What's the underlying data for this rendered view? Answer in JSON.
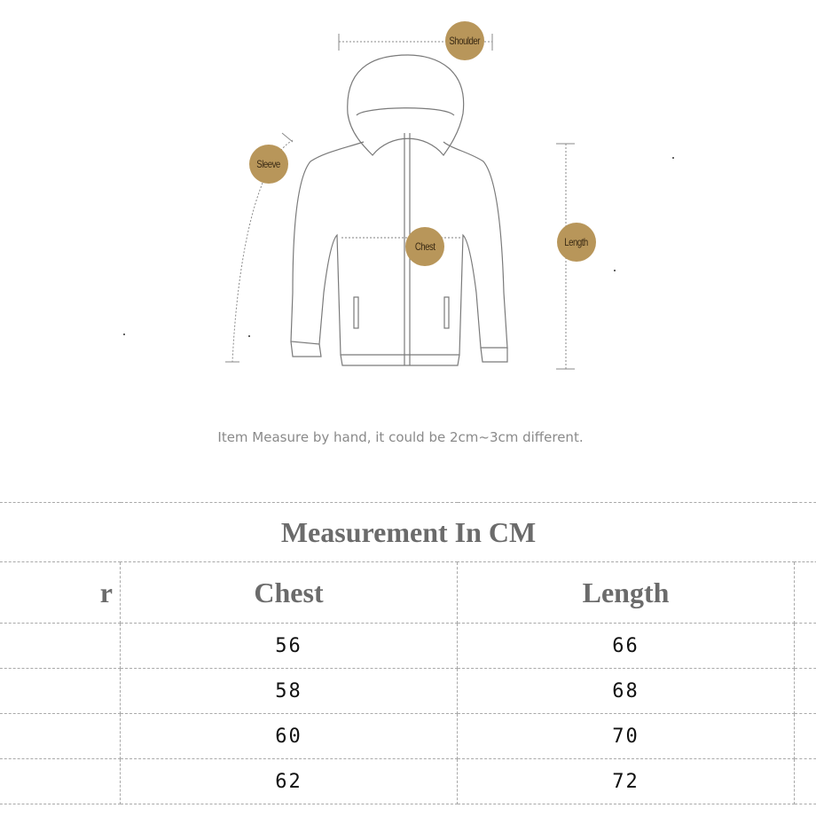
{
  "diagram": {
    "labels": {
      "shoulder": "Shoulder",
      "sleeve": "Sleeve",
      "chest": "Chest",
      "length": "Length"
    },
    "badge_color": "#b8965a"
  },
  "note": "Item Measure by hand, it could be 2cm~3cm different.",
  "table": {
    "title": "Measurement In CM",
    "headers": [
      "r",
      "Chest",
      "Length"
    ],
    "rows": [
      {
        "size": "",
        "chest": "56",
        "length": "66"
      },
      {
        "size": "",
        "chest": "58",
        "length": "68"
      },
      {
        "size": "",
        "chest": "60",
        "length": "70"
      },
      {
        "size": "",
        "chest": "62",
        "length": "72"
      }
    ]
  }
}
